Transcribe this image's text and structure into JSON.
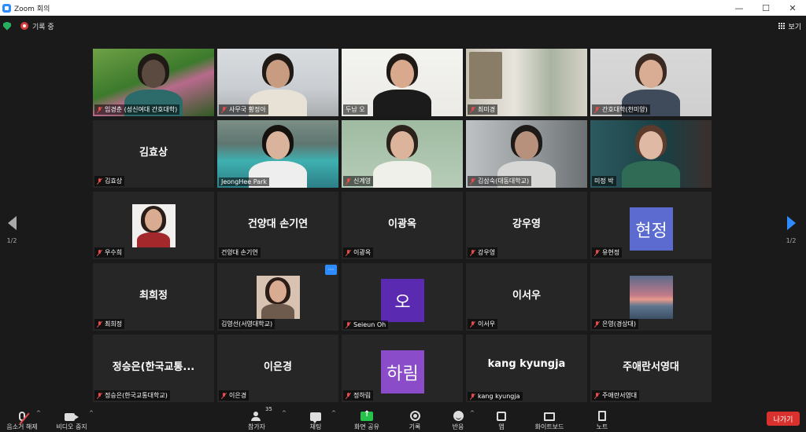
{
  "window": {
    "title": "Zoom 회의",
    "minimize": "—",
    "maximize": "☐",
    "close": "✕"
  },
  "top": {
    "recording_label": "기록 중",
    "view_label": "보기"
  },
  "tiles": [
    {
      "name": "임경춘 (성신여대 간호대학)",
      "type": "video",
      "scene": "flowers"
    },
    {
      "name": "사무국 황정아",
      "type": "video",
      "scene": "office"
    },
    {
      "name": "두남 오",
      "type": "video",
      "scene": "bright",
      "active": true,
      "mic_on": true
    },
    {
      "name": "최미경",
      "type": "video",
      "scene": "room"
    },
    {
      "name": "간호대학(천미양)",
      "type": "video",
      "scene": "wall"
    },
    {
      "name": "김효상",
      "display": "김효상",
      "type": "text"
    },
    {
      "name": "JeongHee Park",
      "type": "video",
      "scene": "lake",
      "mic_on": true
    },
    {
      "name": "신계영",
      "type": "video",
      "scene": "green"
    },
    {
      "name": "김삼숙(대동대학교)",
      "type": "video",
      "scene": "gray"
    },
    {
      "name": "미정 박",
      "type": "video",
      "scene": "teal",
      "mic_on": true
    },
    {
      "name": "우수희",
      "type": "photo"
    },
    {
      "name": "건양대 손기연",
      "display": "건양대 손기연",
      "type": "text",
      "mic_on": true
    },
    {
      "name": "이광옥",
      "display": "이광옥",
      "type": "text"
    },
    {
      "name": "강우영",
      "display": "강우영",
      "type": "text"
    },
    {
      "name": "유현정",
      "type": "avatar",
      "avatar_text": "현정",
      "avatar_color": "#5b6bd0"
    },
    {
      "name": "최희정",
      "display": "최희정",
      "type": "text"
    },
    {
      "name": "김영선(서영대학교)",
      "type": "photo2",
      "more": "···",
      "mic_on": true
    },
    {
      "name": "Seieun Oh",
      "type": "avatar",
      "avatar_text": "오",
      "avatar_color": "#5a2bb0"
    },
    {
      "name": "이서우",
      "display": "이서우",
      "type": "text"
    },
    {
      "name": "은영(경상대)",
      "type": "sunset"
    },
    {
      "name": "정승은(한국교통대학교)",
      "display": "정승은(한국교통...",
      "type": "text"
    },
    {
      "name": "이은경",
      "display": "이은경",
      "type": "text"
    },
    {
      "name": "정하림",
      "type": "avatar",
      "avatar_text": "하림",
      "avatar_color": "#8a4cc8"
    },
    {
      "name": "kang kyungja",
      "display": "kang kyungja",
      "type": "text"
    },
    {
      "name": "주애란서영대",
      "display": "주애란서영대",
      "type": "text"
    }
  ],
  "pagination": {
    "left": "1/2",
    "right": "1/2"
  },
  "toolbar": {
    "unmute": "음소거 해제",
    "stop_video": "비디오 중지",
    "participants": "참가자",
    "participant_count": "35",
    "chat": "채팅",
    "share": "화면 공유",
    "record": "기록",
    "reactions": "반응",
    "apps": "앱",
    "whiteboard": "화이트보드",
    "notes": "노트",
    "leave": "나가기",
    "caret": "^"
  },
  "colors": {
    "accent": "#2d8cff",
    "leave": "#d9312d",
    "share": "#27c24c",
    "active_speaker": "#e8e84a"
  }
}
